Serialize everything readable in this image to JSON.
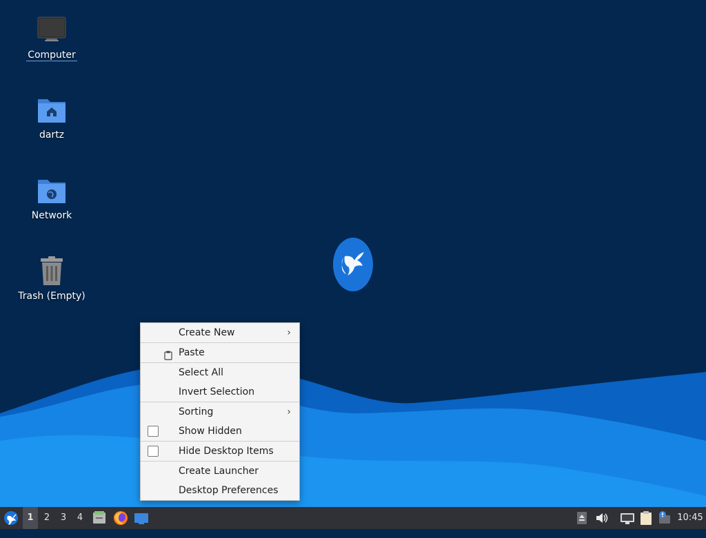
{
  "desktop": {
    "icons": [
      {
        "label": "Computer",
        "icon": "computer-icon"
      },
      {
        "label": "dartz",
        "icon": "home-folder-icon"
      },
      {
        "label": "Network",
        "icon": "network-folder-icon"
      },
      {
        "label": "Trash (Empty)",
        "icon": "trash-icon"
      }
    ],
    "background": {
      "base": "#03274f",
      "wave_dark": "#0a62c2",
      "wave_mid": "#1684e5",
      "wave_light": "#1e9cf5"
    }
  },
  "context_menu": {
    "items": [
      {
        "label": "Create New",
        "submenu": true
      },
      {
        "label": "Paste",
        "icon": "clipboard-icon"
      },
      {
        "label": "Select All"
      },
      {
        "label": "Invert Selection"
      },
      {
        "label": "Sorting",
        "submenu": true
      },
      {
        "label": "Show Hidden",
        "checkbox": true,
        "checked": false
      },
      {
        "label": "Hide Desktop Items",
        "checkbox": true,
        "checked": false
      },
      {
        "label": "Create Launcher"
      },
      {
        "label": "Desktop Preferences"
      }
    ],
    "submenu_arrow": "›"
  },
  "taskbar": {
    "workspaces": [
      "1",
      "2",
      "3",
      "4"
    ],
    "active_workspace": "1",
    "clock": "10:45",
    "launchers": [
      "file-manager-icon",
      "firefox-icon",
      "desktop-icon"
    ],
    "tray": [
      "eject-icon",
      "volume-icon",
      "network-icon",
      "clipboard-icon",
      "update-notifier-icon"
    ]
  }
}
